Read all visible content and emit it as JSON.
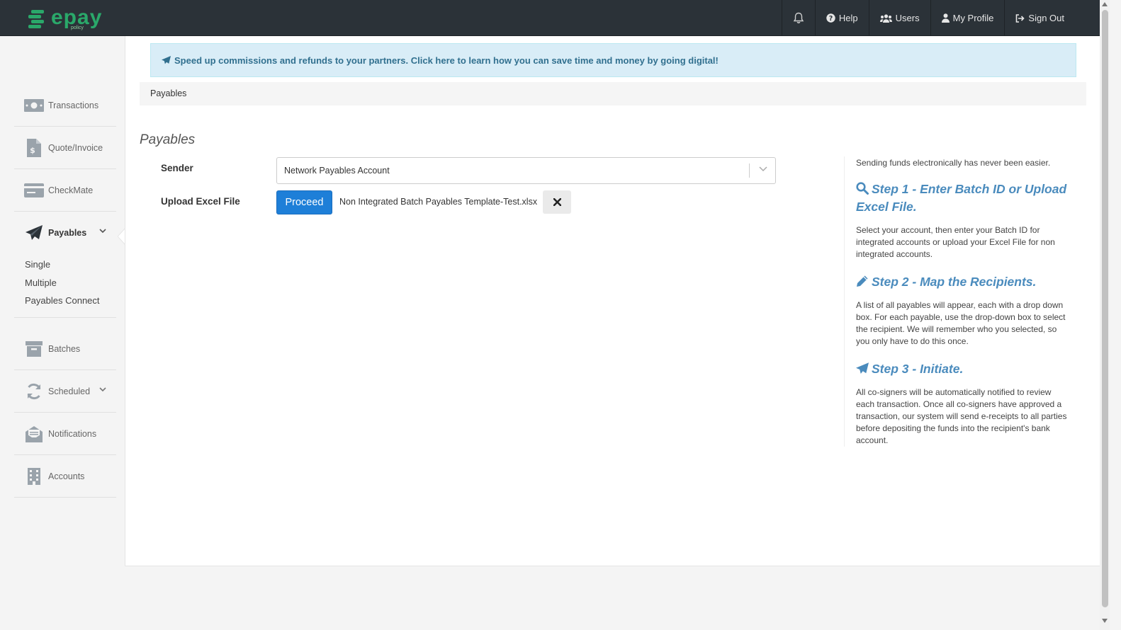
{
  "brand": {
    "name": "epay",
    "sub": "policy"
  },
  "nav": {
    "help": "Help",
    "users": "Users",
    "profile": "My Profile",
    "signout": "Sign Out"
  },
  "sidebar": {
    "items": [
      {
        "label": "Transactions"
      },
      {
        "label": "Quote/Invoice"
      },
      {
        "label": "CheckMate"
      },
      {
        "label": "Payables"
      },
      {
        "label": "Batches"
      },
      {
        "label": "Scheduled"
      },
      {
        "label": "Notifications"
      },
      {
        "label": "Accounts"
      }
    ],
    "submenu": [
      "Single",
      "Multiple",
      "Payables Connect"
    ]
  },
  "alert": "Speed up commissions and refunds to your partners. Click here to learn how you can save time and money by going digital!",
  "breadcrumb": "Payables",
  "page_title": "Payables",
  "form": {
    "sender_label": "Sender",
    "sender_value": "Network Payables Account",
    "upload_label": "Upload Excel File",
    "proceed_label": "Proceed",
    "file_name": "Non Integrated Batch Payables Template-Test.xlsx"
  },
  "help": {
    "intro": "Sending funds electronically has never been easier.",
    "step1_title": "Step 1 - Enter Batch ID or Upload Excel File.",
    "step1_desc": "Select your account, then enter your Batch ID for integrated accounts or upload your Excel File for non integrated accounts.",
    "step2_title": "Step 2 - Map the Recipients.",
    "step2_desc": "A list of all payables will appear, each with a drop down box. For each payable, use the drop-down box to select the recipient. We will remember who you selected, so you only have to do this once.",
    "step3_title": "Step 3 - Initiate.",
    "step3_desc": "All co-signers will be automatically notified to review each transaction. Once all co-signers have approved a transaction, our system will send e-receipts to all parties before depositing the funds into the recipient's bank account."
  },
  "colors": {
    "accent": "#1e7fd8",
    "brand_green": "#2aa86a",
    "topbar": "#2b3238",
    "help_blue": "#4a8bbd"
  }
}
